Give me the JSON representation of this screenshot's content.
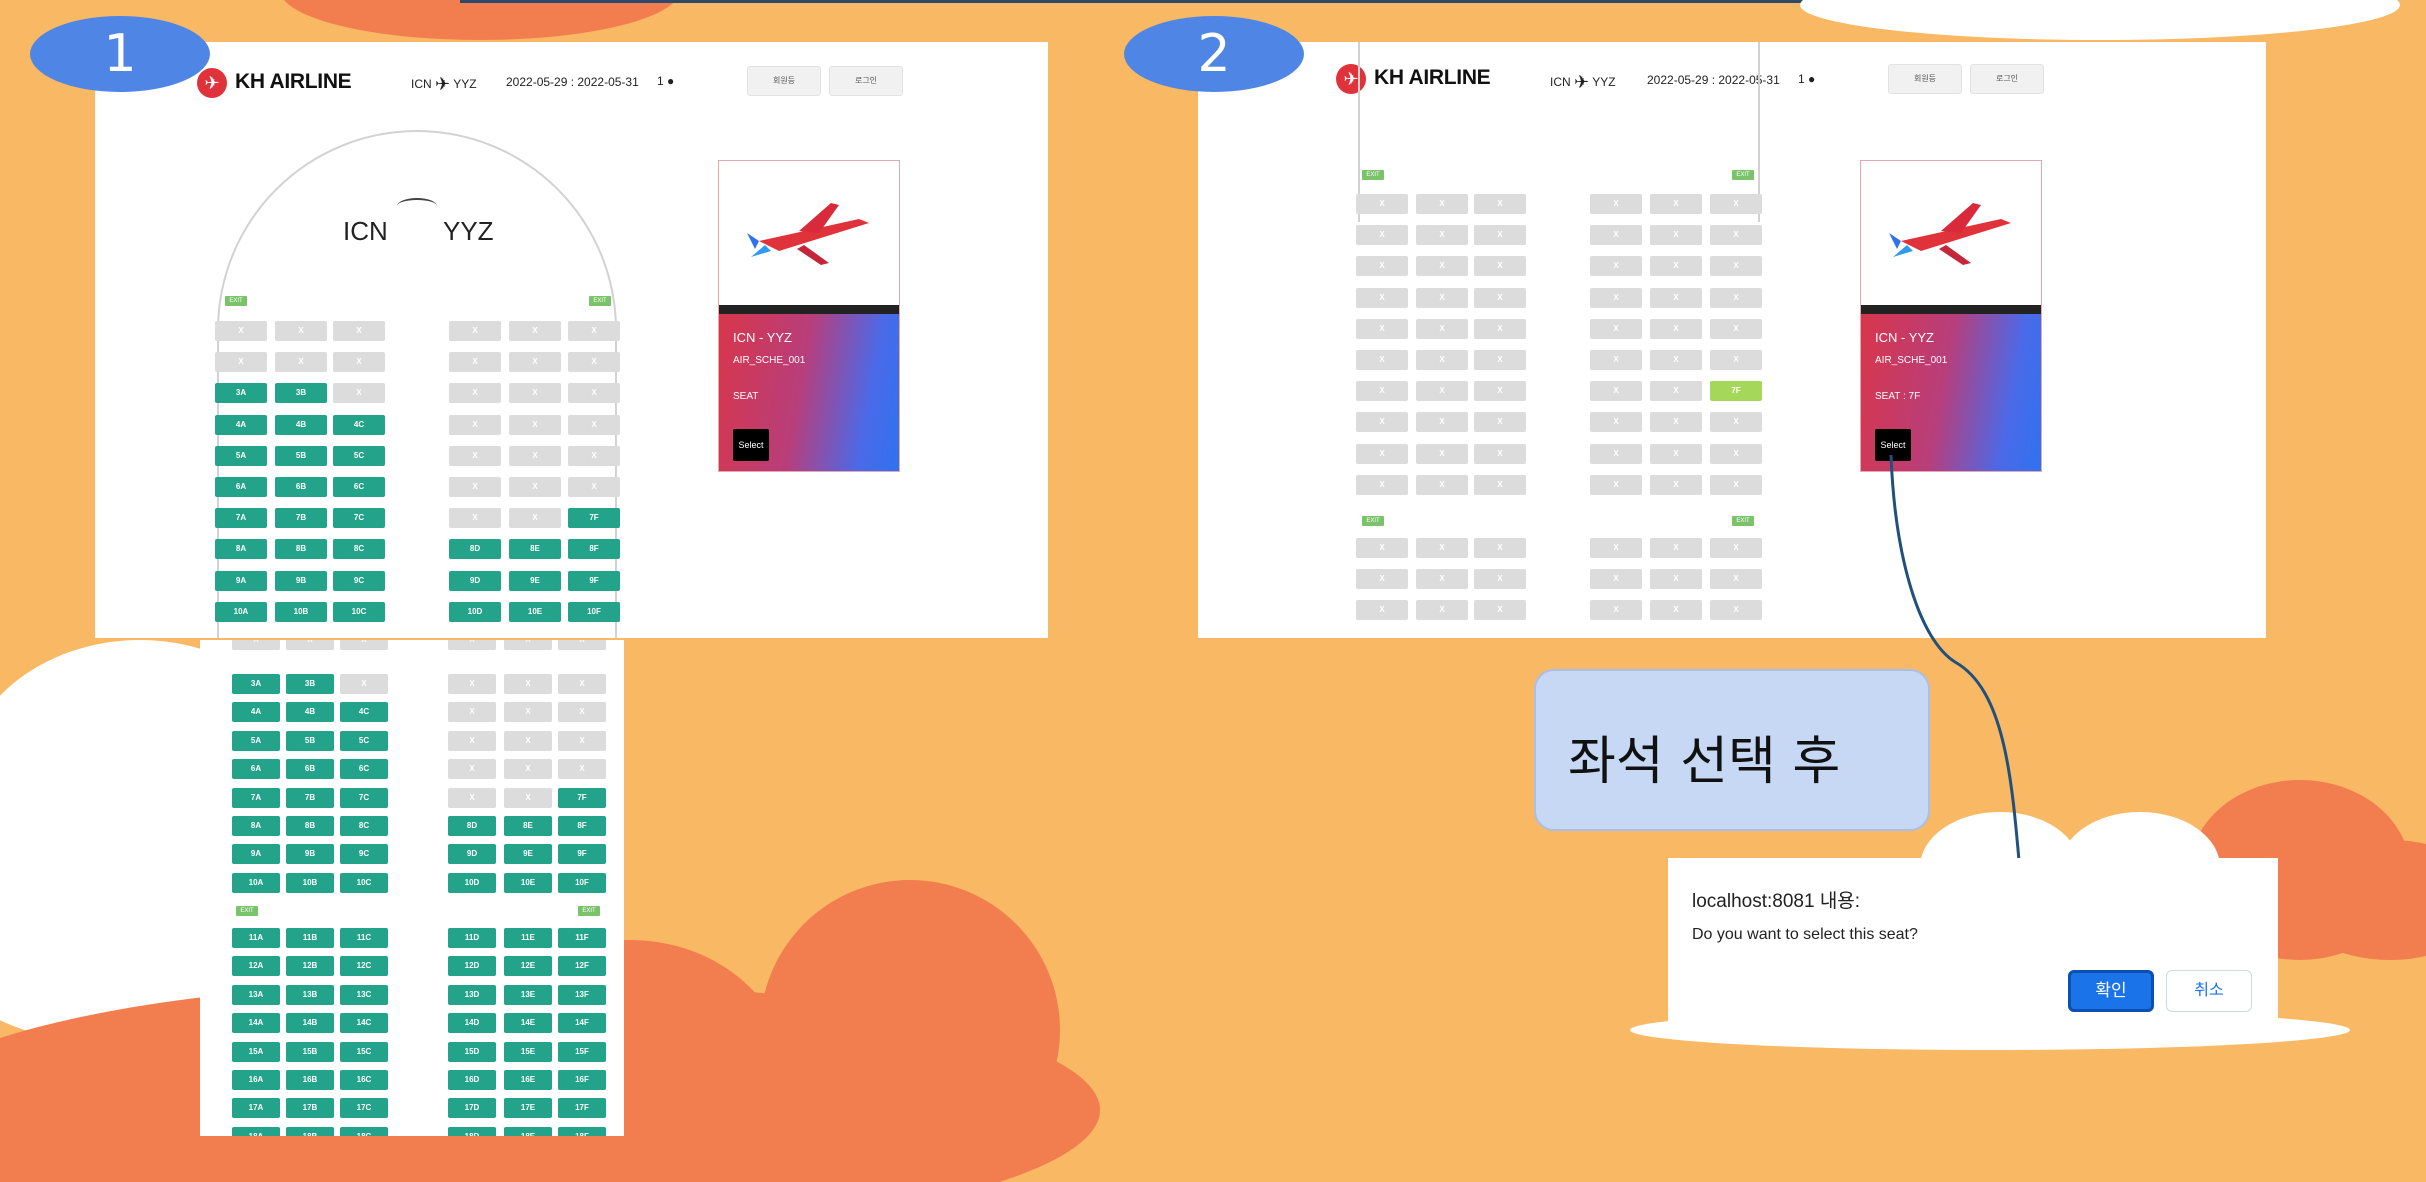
{
  "step1": {
    "badge": "1",
    "logo": "KH AIRLINE",
    "route_from": "ICN",
    "route_to": "YYZ",
    "dates": "2022-05-29 : 2022-05-31",
    "pax": "1",
    "btn_signup": "회원등",
    "btn_login": "로그인",
    "hero_from": "ICN",
    "hero_to": "YYZ",
    "card": {
      "route": "ICN - YYZ",
      "schedule": "AIR_SCHE_001",
      "seat": "SEAT",
      "select": "Select"
    }
  },
  "step2": {
    "badge": "2",
    "logo": "KH AIRLINE",
    "route_from": "ICN",
    "route_to": "YYZ",
    "dates": "2022-05-29 : 2022-05-31",
    "pax": "1",
    "btn_signup": "회원등",
    "btn_login": "로그인",
    "card": {
      "route": "ICN - YYZ",
      "schedule": "AIR_SCHE_001",
      "seat": "SEAT : 7F",
      "select": "Select"
    },
    "selected_seat": "7F"
  },
  "exit_label": "EXIT",
  "taken_label": "X",
  "note": "좌석 선택 후",
  "dialog": {
    "title": "localhost:8081 내용:",
    "message": "Do you want to select this seat?",
    "ok": "확인",
    "cancel": "취소"
  },
  "icons": [
    "plane-logo-icon",
    "plane-route-icon",
    "person-icon",
    "airplane-illustration",
    "curve-arrow-icon"
  ],
  "colors": {
    "open_seat": "#22a38a",
    "taken_seat": "#dcdcdc",
    "selected_seat": "#a5d75a",
    "badge": "#4f86e6",
    "ok_button": "#1a73e8"
  }
}
